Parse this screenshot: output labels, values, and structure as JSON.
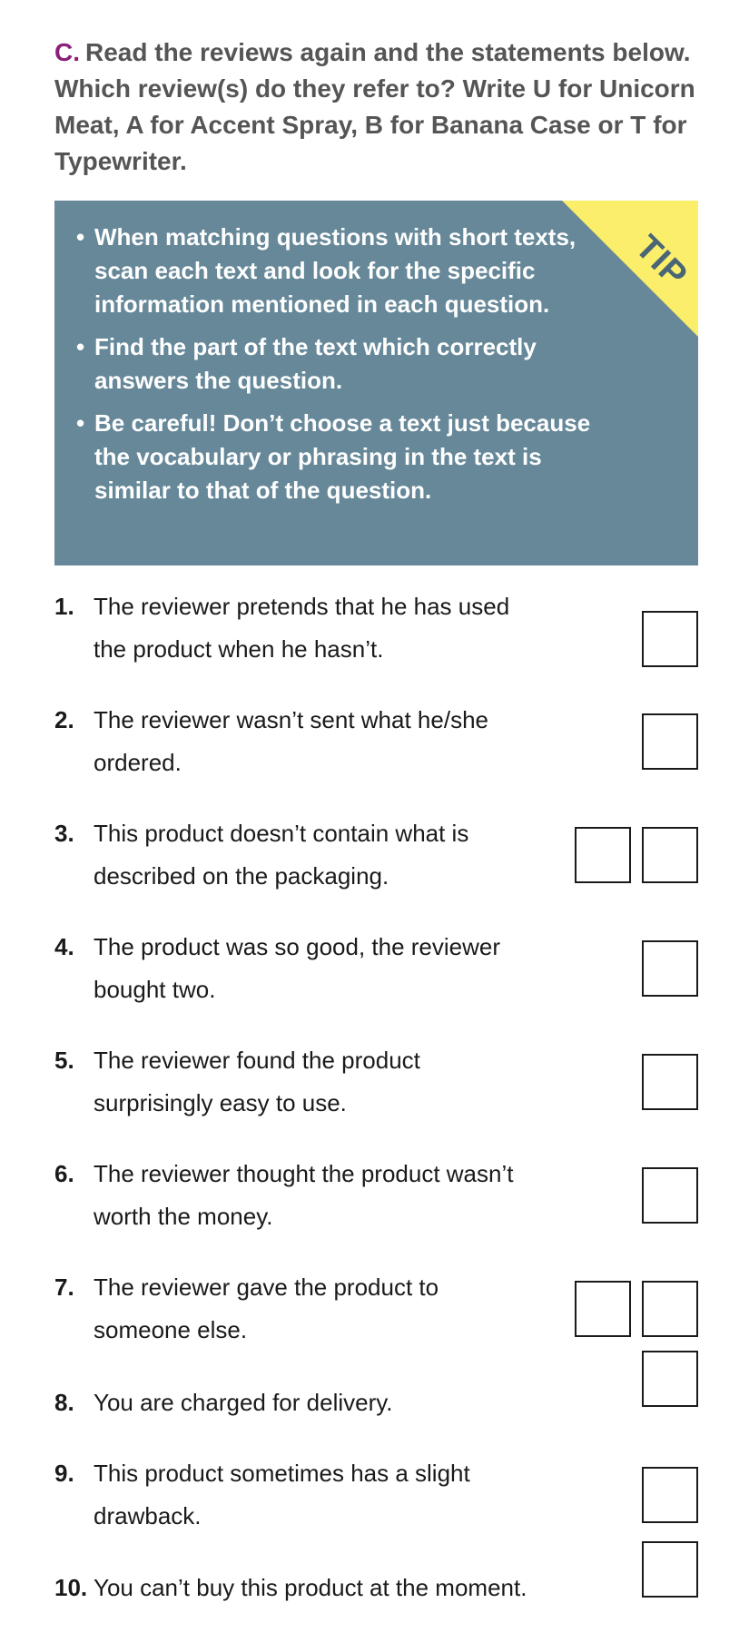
{
  "instructions": {
    "section_letter": "C.",
    "text": "Read the reviews again and the statements below. Which review(s) do they refer to? Write U for Unicorn Meat, A for Accent Spray, B for Banana Case or T for Typewriter."
  },
  "tip": {
    "label": "TIP",
    "items": [
      "When matching questions with short texts, scan each text and look for the specific information mentioned in each question.",
      "Find the part of the text which correctly answers the question.",
      "Be careful! Don’t choose a text just because the vocabulary or phrasing in the text is similar to that of the question."
    ]
  },
  "questions": [
    {
      "number": "1.",
      "line1": "The reviewer pretends that he has used",
      "line2": "the product when he hasn’t.",
      "answer_boxes": 1
    },
    {
      "number": "2.",
      "line1": "The reviewer wasn’t sent what he/she",
      "line2": "ordered.",
      "answer_boxes": 1
    },
    {
      "number": "3.",
      "line1": "This product doesn’t contain what is",
      "line2": "described on the packaging.",
      "answer_boxes": 2
    },
    {
      "number": "4.",
      "line1": "The product was so good, the reviewer",
      "line2": "bought two.",
      "answer_boxes": 1
    },
    {
      "number": "5.",
      "line1": "The reviewer found the product",
      "line2": "surprisingly easy to use.",
      "answer_boxes": 1
    },
    {
      "number": "6.",
      "line1": "The reviewer thought the product wasn’t",
      "line2": "worth the money.",
      "answer_boxes": 1
    },
    {
      "number": "7.",
      "line1": "The reviewer gave the product to",
      "line2": "someone else.",
      "answer_boxes": 2
    },
    {
      "number": "8.",
      "line1": "You are charged for delivery.",
      "line2": "",
      "answer_boxes": 1
    },
    {
      "number": "9.",
      "line1": "This product sometimes has a slight",
      "line2": "drawback.",
      "answer_boxes": 1
    },
    {
      "number": "10.",
      "line1": "You can’t buy this product at the moment.",
      "line2": "",
      "answer_boxes": 1
    }
  ],
  "colors": {
    "section_letter": "#8a1f7a",
    "instruction_text": "#555555",
    "tip_background": "#668899",
    "tip_corner": "#fbee6a",
    "tip_label": "#4a6676"
  }
}
